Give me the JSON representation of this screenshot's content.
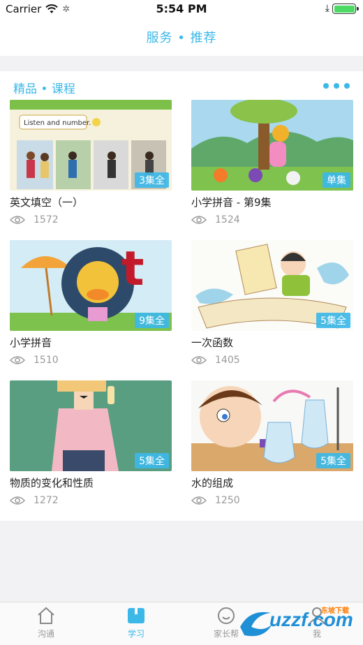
{
  "status_bar": {
    "carrier": "Carrier",
    "time": "5:54 PM"
  },
  "header": {
    "title": "服务 • 推荐"
  },
  "section": {
    "title": "精品 • 课程"
  },
  "courses": [
    {
      "title": "英文填空（一）",
      "views": "1572",
      "badge": "3集全",
      "thumb_text": "Listen and number."
    },
    {
      "title": "小学拼音 - 第9集",
      "views": "1524",
      "badge": "单集",
      "thumb_text": ""
    },
    {
      "title": "小学拼音",
      "views": "1510",
      "badge": "9集全",
      "thumb_text": "t"
    },
    {
      "title": "一次函数",
      "views": "1405",
      "badge": "5集全",
      "thumb_text": ""
    },
    {
      "title": "物质的变化和性质",
      "views": "1272",
      "badge": "5集全",
      "thumb_text": ""
    },
    {
      "title": "水的组成",
      "views": "1250",
      "badge": "5集全",
      "thumb_text": ""
    }
  ],
  "tabs": [
    {
      "label": "沟通",
      "icon": "home-icon"
    },
    {
      "label": "学习",
      "icon": "book-icon"
    },
    {
      "label": "家长帮",
      "icon": "smile-icon"
    },
    {
      "label": "我",
      "icon": "person-icon"
    }
  ],
  "watermark": {
    "text": "uzzf.com",
    "sub": "东坡下载"
  },
  "colors": {
    "accent": "#3cb8e8",
    "battery": "#4cd964"
  }
}
